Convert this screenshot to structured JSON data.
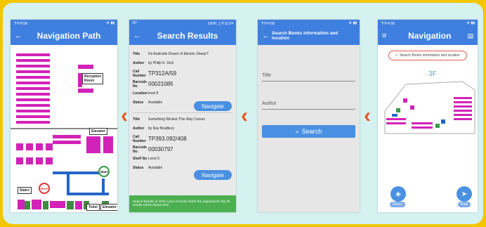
{
  "colors": {
    "accent": "#3f7fe0",
    "arrow": "#e8541e",
    "green": "#4caf50"
  },
  "phone1": {
    "time": "下午4:58",
    "title": "Navigation Path",
    "labels": {
      "reception": "Reception Room",
      "elevator": "Elevator",
      "stairs": "Stairs",
      "here": "Here",
      "start": "Start",
      "toilet": "Toilet",
      "elevator2": "Elevator"
    }
  },
  "phone2": {
    "status_left": "25°",
    "status_right": "100% 上午11:04",
    "title": "Search Results",
    "books": [
      {
        "title": "Do Androids Dream of Electric Sheep?",
        "author": "by Philip K. Dick",
        "call": "TP312A/59",
        "barcode": "00021085",
        "location": "level 8",
        "status": "Available"
      },
      {
        "title": "Something Wicked This Way Comes",
        "author": "by Ray Bradbury",
        "call": "TP393.092/408",
        "barcode": "00030797",
        "location": "Level 5",
        "status": "Available"
      }
    ],
    "keys": {
      "title": "Title",
      "author": "Author",
      "call": "Call Number",
      "barcode": "Barcode No",
      "location": "Location",
      "shelf": "Shelf No",
      "status": "Status"
    },
    "navigate": "Navigate",
    "footer": "Search Results of 1575 count of books match the requirement Top 30 results will be shown here"
  },
  "phone3": {
    "time": "下午4:58",
    "title": "Search Books information and location",
    "title_label": "Title",
    "author_label": "Author",
    "search_label": "Search"
  },
  "phone4": {
    "time": "下午4:58",
    "title": "Navigation",
    "search_placeholder": "Search Books information and location",
    "floor": "3F",
    "floors_label": "Floors",
    "path_label": "Path"
  }
}
